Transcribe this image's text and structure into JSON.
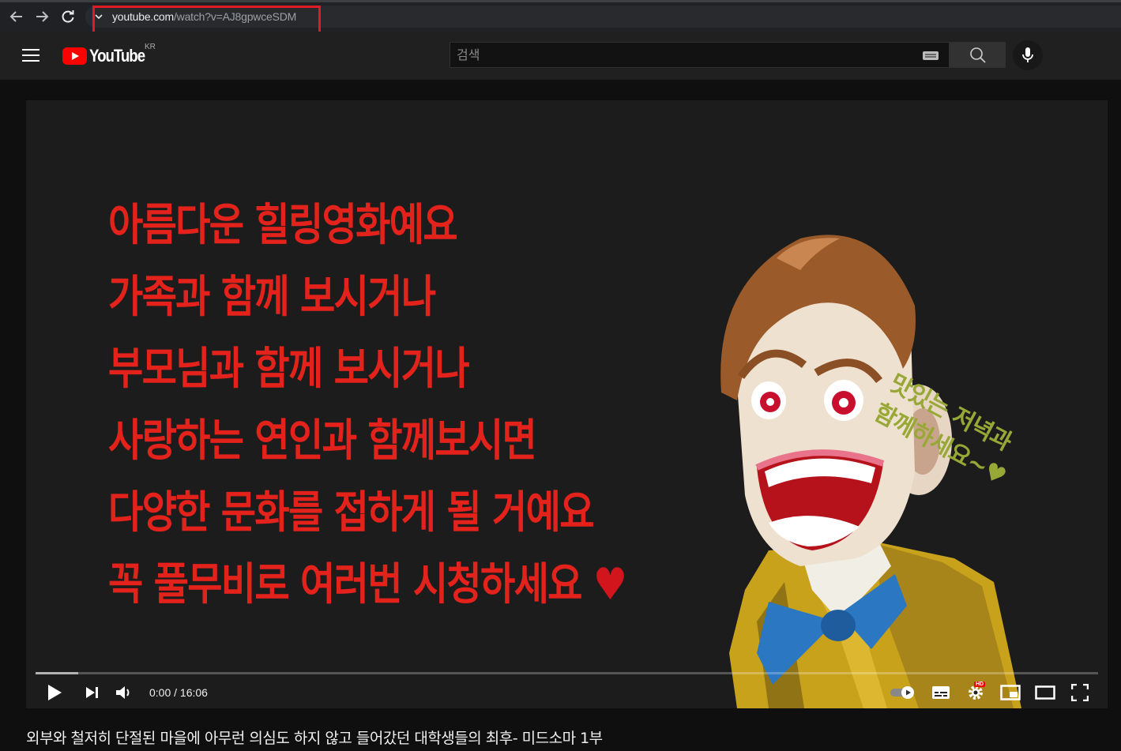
{
  "browser": {
    "url_host": "youtube.com",
    "url_path": "/watch?v=AJ8gpwceSDM"
  },
  "masthead": {
    "logo_text": "YouTube",
    "region": "KR",
    "search_placeholder": "검색"
  },
  "player": {
    "overlay_lines": [
      "아름다운 힐링영화예요",
      "가족과 함께 보시거나",
      "부모님과 함께 보시거나",
      "사랑하는 연인과 함께보시면",
      "다양한 문화를 접하게 될 거예요",
      "꼭 풀무비로 여러번 시청하세요"
    ],
    "overlay_heart": "♥",
    "figure_caption": [
      "맛있는 저녁과",
      "함께하세요~♥"
    ],
    "time_current": "0:00",
    "time_separator": " / ",
    "time_total": "16:06",
    "hd_badge": "HD"
  },
  "video": {
    "title": "외부와 철저히 단절된 마을에 아무런 의심도 하지 않고 들어갔던 대학생들의 최후- 미드소마 1부"
  },
  "colors": {
    "overlay_text": "#e3221c",
    "brand_red": "#ff0000",
    "highlight_box": "#e01b24"
  },
  "icons": {
    "back": "arrow-left-icon",
    "forward": "arrow-right-icon",
    "reload": "reload-icon",
    "menu": "hamburger-menu-icon",
    "search": "search-icon",
    "mic": "microphone-icon",
    "keyboard": "keyboard-icon",
    "play": "play-icon",
    "next": "skip-next-icon",
    "volume": "volume-icon",
    "autoplay": "autoplay-toggle-icon",
    "subtitles": "subtitles-icon",
    "settings": "gear-icon",
    "miniplayer": "miniplayer-icon",
    "theater": "theater-mode-icon",
    "fullscreen": "fullscreen-icon"
  }
}
